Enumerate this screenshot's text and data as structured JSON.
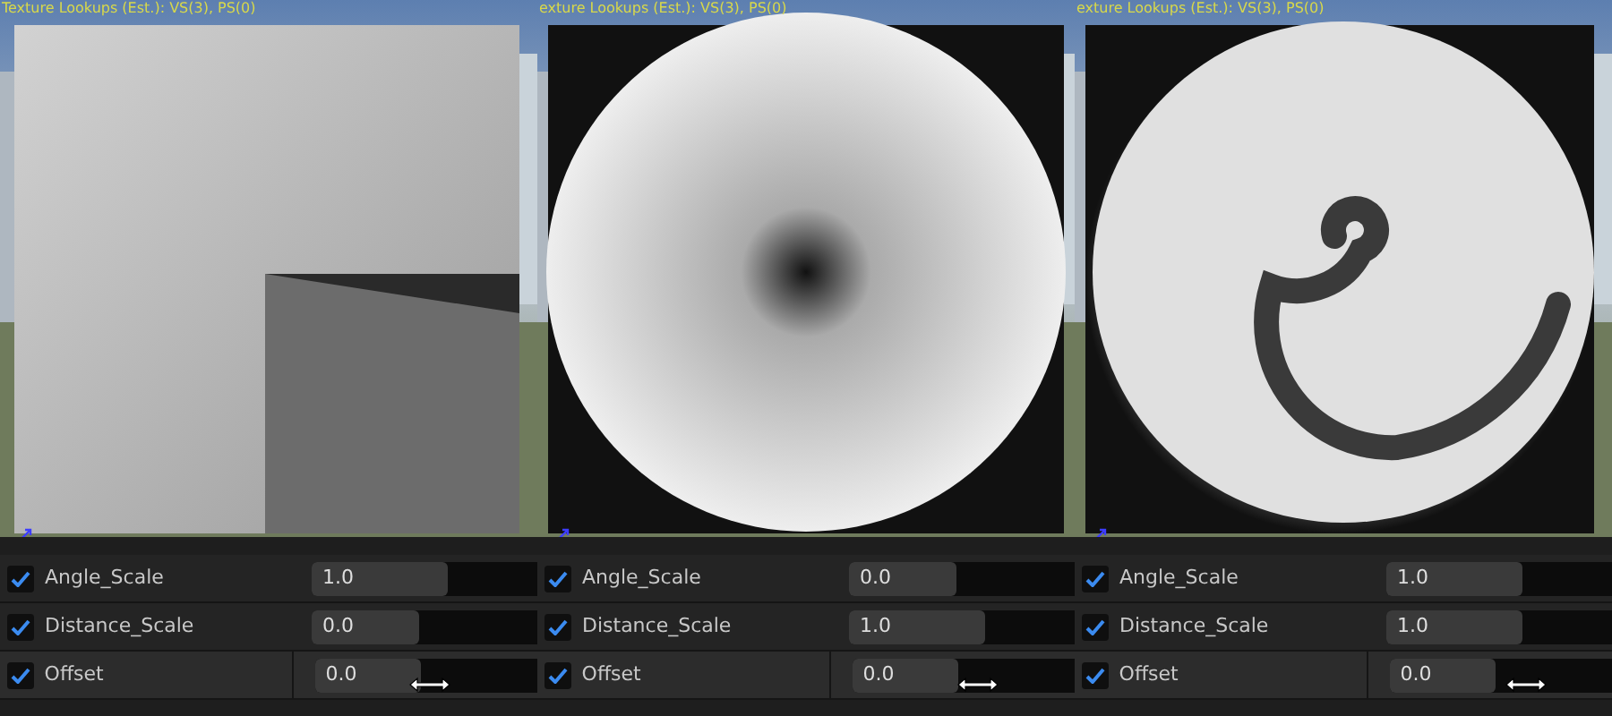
{
  "panels": [
    {
      "viewport": {
        "kind": "picture",
        "stats": "Texture Lookups (Est.): VS(3), PS(0)"
      },
      "parameters": [
        {
          "name": "Angle_Scale",
          "checked": true,
          "value": "1.0",
          "level": 0.6,
          "hovered": false
        },
        {
          "name": "Distance_Scale",
          "checked": true,
          "value": "0.0",
          "level": 0.48,
          "hovered": false
        },
        {
          "name": "Offset",
          "checked": true,
          "value": "0.0",
          "level": 0.48,
          "hovered": true
        }
      ]
    },
    {
      "viewport": {
        "kind": "picture",
        "stats": "exture Lookups (Est.): VS(3), PS(0)"
      },
      "parameters": [
        {
          "name": "Angle_Scale",
          "checked": true,
          "value": "0.0",
          "level": 0.48,
          "hovered": false
        },
        {
          "name": "Distance_Scale",
          "checked": true,
          "value": "1.0",
          "level": 0.6,
          "hovered": false
        },
        {
          "name": "Offset",
          "checked": true,
          "value": "0.0",
          "level": 0.48,
          "hovered": true
        }
      ]
    },
    {
      "viewport": {
        "kind": "picture",
        "stats": "exture Lookups (Est.): VS(3), PS(0)"
      },
      "parameters": [
        {
          "name": "Angle_Scale",
          "checked": true,
          "value": "1.0",
          "level": 0.6,
          "hovered": false
        },
        {
          "name": "Distance_Scale",
          "checked": true,
          "value": "1.0",
          "level": 0.6,
          "hovered": false
        },
        {
          "name": "Offset",
          "checked": true,
          "value": "0.0",
          "level": 0.48,
          "hovered": true
        }
      ]
    }
  ]
}
